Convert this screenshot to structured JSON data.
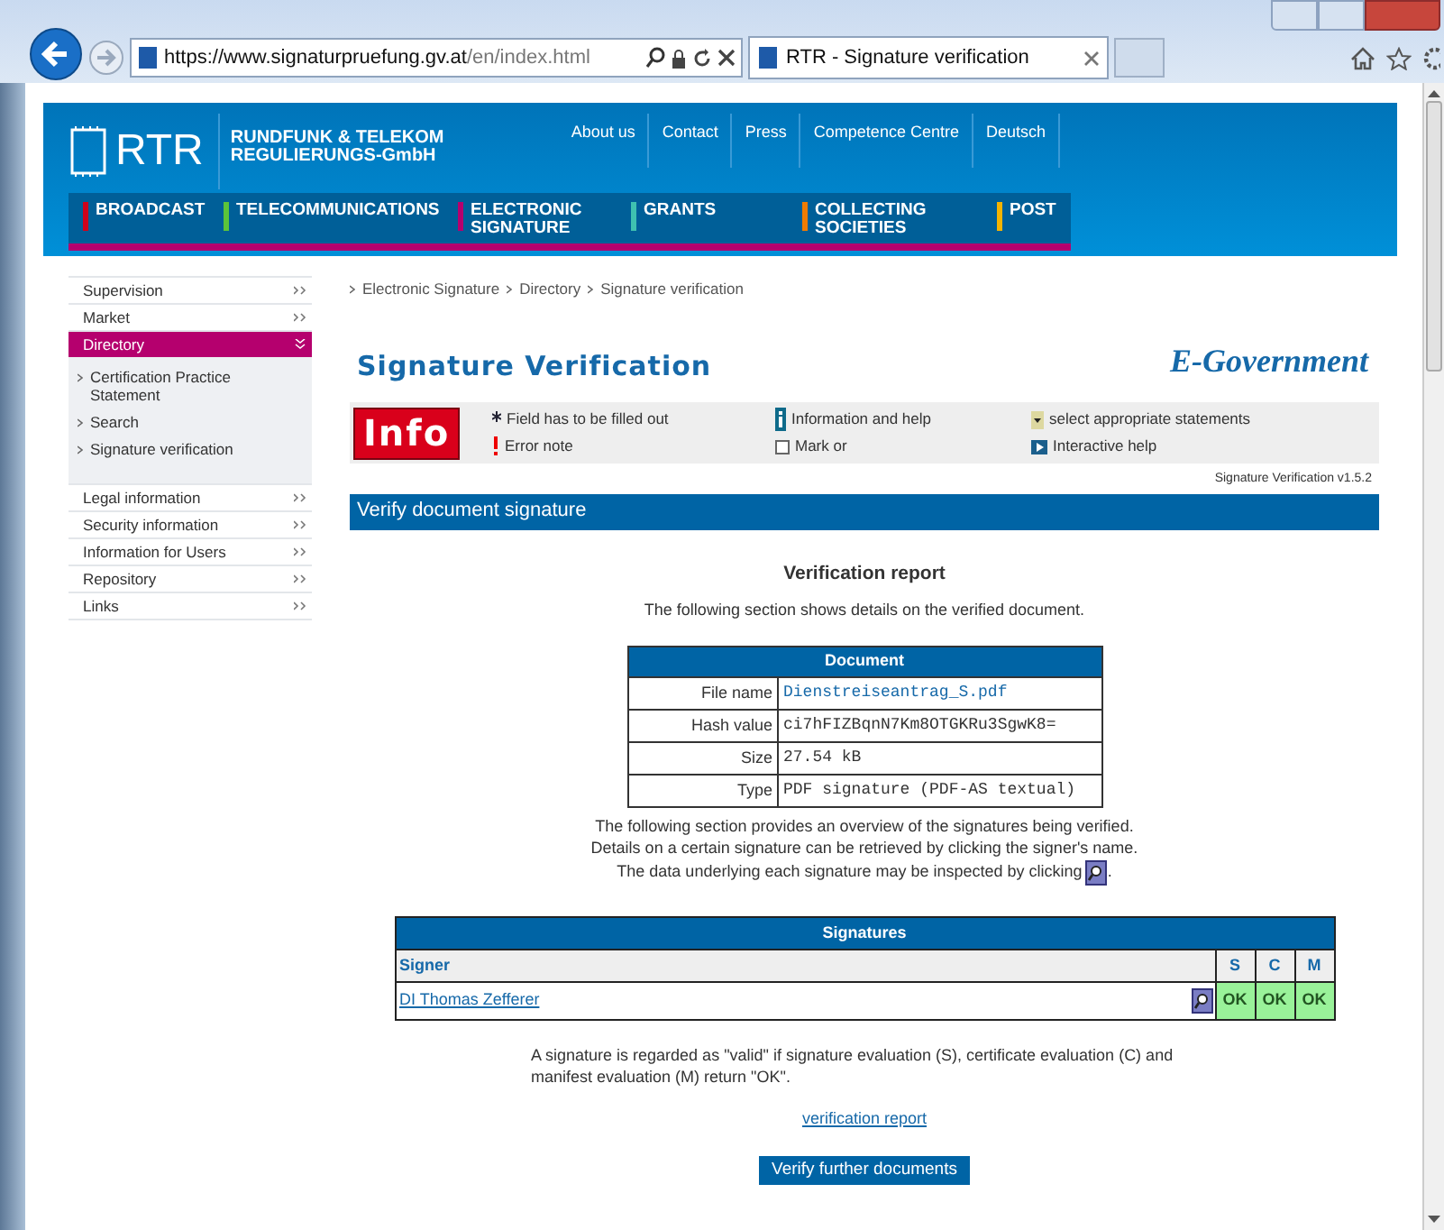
{
  "browser": {
    "url_host": "https://www.signaturpruefung.gv.at",
    "url_path": "/en/index.html",
    "tab_title": "RTR - Signature verification"
  },
  "header": {
    "logo_text": "RTR",
    "org_name": [
      "RUNDFUNK & TELEKOM",
      "REGULIERUNGS-GmbH"
    ],
    "top_links": [
      "About us",
      "Contact",
      "Press",
      "Competence Centre",
      "Deutsch"
    ],
    "nav": [
      {
        "label": "BROADCAST",
        "color": "#d0021b"
      },
      {
        "label": "TELECOMMUNICATIONS",
        "color": "#5cc43a"
      },
      {
        "label": "ELECTRONIC SIGNATURE",
        "color": "#b5006e"
      },
      {
        "label": "GRANTS",
        "color": "#3fc1b0"
      },
      {
        "label": "COLLECTING SOCIETIES",
        "color": "#f07c00"
      },
      {
        "label": "POST",
        "color": "#f5b400"
      }
    ]
  },
  "sidebar": {
    "items": [
      {
        "label": "Supervision",
        "selected": false,
        "expanded": false
      },
      {
        "label": "Market",
        "selected": false,
        "expanded": false
      },
      {
        "label": "Directory",
        "selected": true,
        "expanded": true,
        "children": [
          {
            "label": "Certification Practice Statement"
          },
          {
            "label": "Search"
          },
          {
            "label": "Signature verification"
          }
        ]
      },
      {
        "label": "Legal information",
        "selected": false,
        "expanded": false
      },
      {
        "label": "Security information",
        "selected": false,
        "expanded": false
      },
      {
        "label": "Information for Users",
        "selected": false,
        "expanded": false
      },
      {
        "label": "Repository",
        "selected": false,
        "expanded": false
      },
      {
        "label": "Links",
        "selected": false,
        "expanded": false
      }
    ]
  },
  "breadcrumb": [
    "Electronic Signature",
    "Directory",
    "Signature verification"
  ],
  "page_title": "Signature Verification",
  "brand": "E-Government",
  "info_badge": "Info",
  "legend": [
    {
      "kind": "asterisk",
      "label": "Field has to be filled out"
    },
    {
      "kind": "info",
      "label": "Information and help"
    },
    {
      "kind": "dropdown",
      "label": "select appropriate statements"
    },
    {
      "kind": "exclamation",
      "label": "Error note"
    },
    {
      "kind": "checkbox",
      "label": "Mark or"
    },
    {
      "kind": "play",
      "label": "Interactive help"
    }
  ],
  "version": "Signature Verification v1.5.2",
  "section_title": "Verify document signature",
  "report_title": "Verification report",
  "report_intro": "The following section shows details on the verified document.",
  "document": {
    "title": "Document",
    "rows": [
      {
        "label": "File name",
        "value": "Dienstreiseantrag_S.pdf",
        "link": true
      },
      {
        "label": "Hash value",
        "value": "ci7hFIZBqnN7Km8OTGKRu3SgwK8=",
        "link": false
      },
      {
        "label": "Size",
        "value": "27.54 kB",
        "link": false
      },
      {
        "label": "Type",
        "value": "PDF signature (PDF-AS textual)",
        "link": false
      }
    ]
  },
  "overview_text": [
    "The following section provides an overview of the signatures being verified.",
    "Details on a certain signature can be retrieved by clicking the signer's name."
  ],
  "inspect_text": "The data underlying each signature may be inspected by clicking",
  "inspect_end": ".",
  "signatures": {
    "title": "Signatures",
    "columns": [
      "Signer",
      "S",
      "C",
      "M"
    ],
    "rows": [
      {
        "signer": "DI Thomas Zefferer",
        "results": [
          "OK",
          "OK",
          "OK"
        ]
      }
    ]
  },
  "validity_note": "A signature is regarded as \"valid\" if signature evaluation (S), certificate evaluation (C) and manifest evaluation (M) return \"OK\".",
  "report_link": "verification report",
  "button": "Verify further documents"
}
